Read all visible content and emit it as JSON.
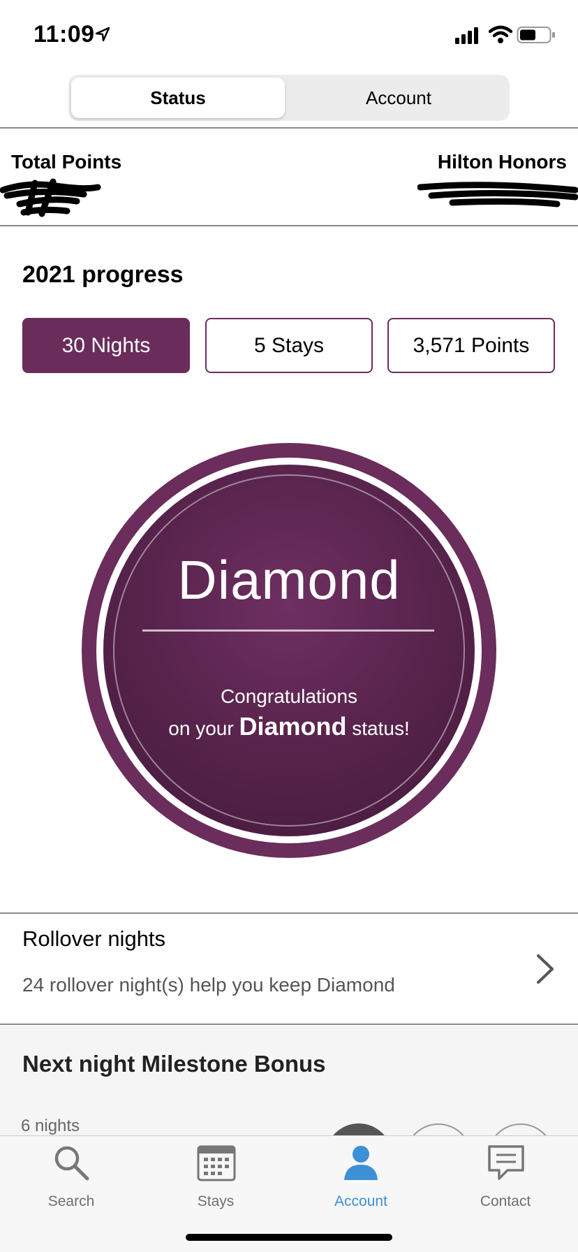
{
  "status_bar": {
    "time": "11:09"
  },
  "segmented": {
    "tabs": [
      "Status",
      "Account"
    ],
    "selected": "Status"
  },
  "points_header": {
    "total_points_label": "Total Points",
    "program_label": "Hilton Honors"
  },
  "progress": {
    "title": "2021 progress",
    "pills": [
      {
        "label": "30 Nights",
        "active": true
      },
      {
        "label": "5 Stays",
        "active": false
      },
      {
        "label": "3,571 Points",
        "active": false
      }
    ]
  },
  "medallion": {
    "tier": "Diamond",
    "congrats_line1": "Congratulations",
    "congrats_prefix": "on your",
    "congrats_tier": "Diamond",
    "congrats_suffix": "status!"
  },
  "rollover": {
    "title": "Rollover nights",
    "subtitle": "24 rollover night(s) help you keep Diamond"
  },
  "milestone": {
    "title": "Next night Milestone Bonus",
    "nights_label": "6 nights"
  },
  "tabbar": {
    "items": [
      {
        "label": "Search",
        "icon": "search-icon"
      },
      {
        "label": "Stays",
        "icon": "calendar-icon"
      },
      {
        "label": "Account",
        "icon": "person-icon",
        "active": true
      },
      {
        "label": "Contact",
        "icon": "chat-icon"
      }
    ]
  },
  "colors": {
    "brand": "#6a2c5b",
    "active_tab": "#3d8fd6"
  }
}
